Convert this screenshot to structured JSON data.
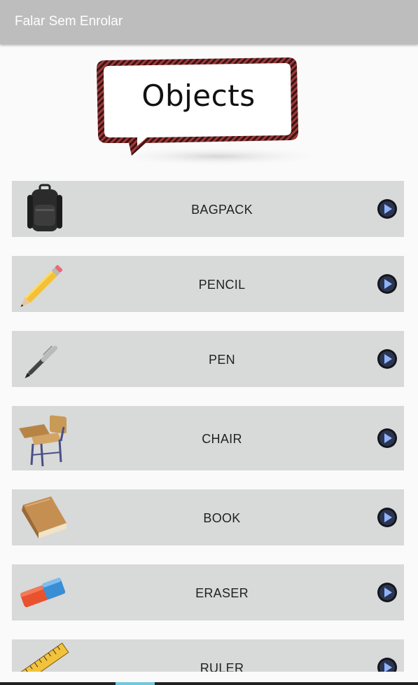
{
  "app": {
    "title": "Falar Sem Enrolar"
  },
  "banner": {
    "title": "Objects"
  },
  "items": [
    {
      "label": "BAGPACK",
      "icon": "backpack-icon"
    },
    {
      "label": "PENCIL",
      "icon": "pencil-icon"
    },
    {
      "label": "PEN",
      "icon": "pen-icon"
    },
    {
      "label": "CHAIR",
      "icon": "chair-icon"
    },
    {
      "label": "BOOK",
      "icon": "book-icon"
    },
    {
      "label": "ERASER",
      "icon": "eraser-icon"
    },
    {
      "label": "RULER",
      "icon": "ruler-icon"
    }
  ],
  "colors": {
    "appbar": "#bdbdbd",
    "row": "#d8d9d9",
    "banner_border": "#8b2a2a"
  }
}
